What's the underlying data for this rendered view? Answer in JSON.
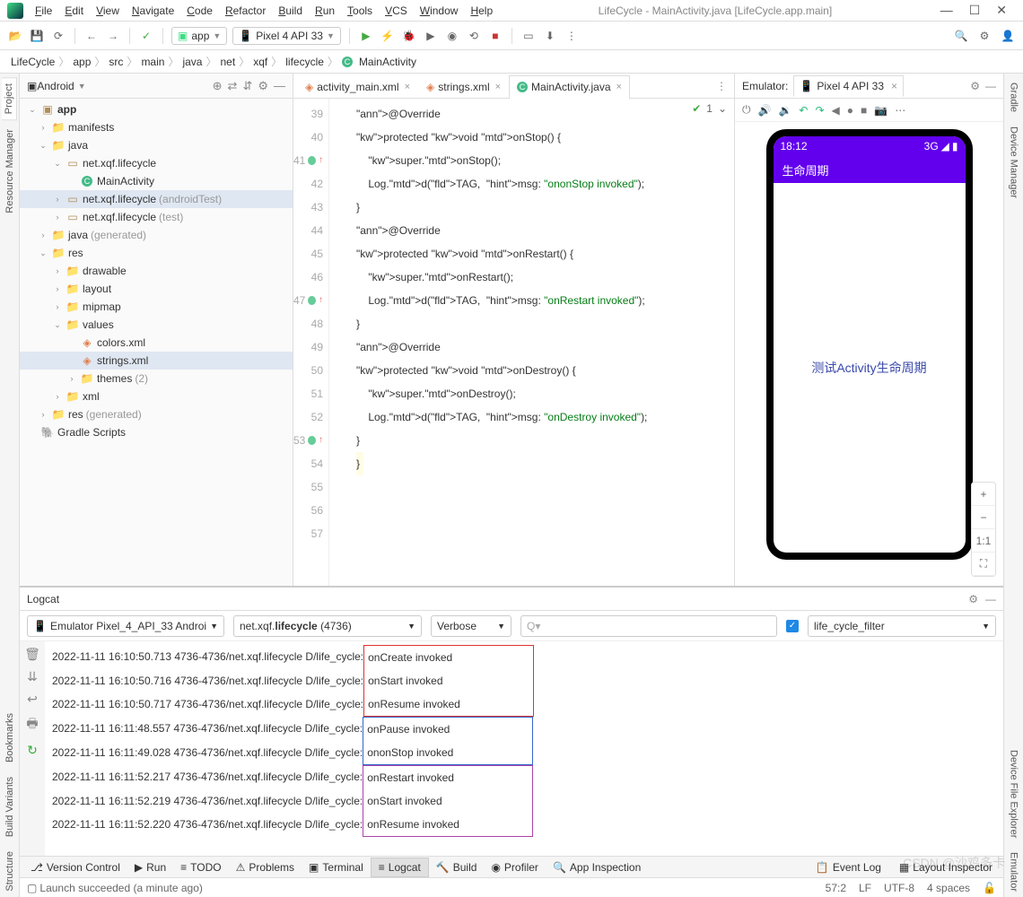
{
  "window": {
    "title_left": "LifeCycle - MainActivity.java [LifeCycle.app.main]"
  },
  "menu": [
    "File",
    "Edit",
    "View",
    "Navigate",
    "Code",
    "Refactor",
    "Build",
    "Run",
    "Tools",
    "VCS",
    "Window",
    "Help"
  ],
  "toolbar": {
    "module": "app",
    "device": "Pixel 4 API 33"
  },
  "breadcrumb": [
    "LifeCycle",
    "app",
    "src",
    "main",
    "java",
    "net",
    "xqf",
    "lifecycle",
    "MainActivity"
  ],
  "left_stripe": [
    "Project",
    "Resource Manager"
  ],
  "right_stripe": [
    "Gradle",
    "Device Manager"
  ],
  "left_stripe_bottom": [
    "Bookmarks",
    "Build Variants",
    "Structure"
  ],
  "right_stripe_bottom": [
    "Device File Explorer",
    "Emulator"
  ],
  "project": {
    "mode": "Android",
    "tree": [
      {
        "label": "app",
        "ind": 0,
        "open": true,
        "type": "module",
        "bold": true
      },
      {
        "label": "manifests",
        "ind": 1,
        "type": "folder"
      },
      {
        "label": "java",
        "ind": 1,
        "open": true,
        "type": "folder"
      },
      {
        "label": "net.xqf.lifecycle",
        "ind": 2,
        "open": true,
        "type": "pkg"
      },
      {
        "label": "MainActivity",
        "ind": 3,
        "type": "class"
      },
      {
        "label": "net.xqf.lifecycle",
        "suffix": "(androidTest)",
        "ind": 2,
        "type": "pkg",
        "sel": true
      },
      {
        "label": "net.xqf.lifecycle",
        "suffix": "(test)",
        "ind": 2,
        "type": "pkg"
      },
      {
        "label": "java",
        "suffix": "(generated)",
        "ind": 1,
        "type": "folder-gen"
      },
      {
        "label": "res",
        "ind": 1,
        "open": true,
        "type": "folder"
      },
      {
        "label": "drawable",
        "ind": 2,
        "type": "folder"
      },
      {
        "label": "layout",
        "ind": 2,
        "type": "folder"
      },
      {
        "label": "mipmap",
        "ind": 2,
        "type": "folder"
      },
      {
        "label": "values",
        "ind": 2,
        "open": true,
        "type": "folder"
      },
      {
        "label": "colors.xml",
        "ind": 3,
        "type": "xml"
      },
      {
        "label": "strings.xml",
        "ind": 3,
        "type": "xml",
        "sel": true
      },
      {
        "label": "themes",
        "suffix": "(2)",
        "ind": 3,
        "type": "folder"
      },
      {
        "label": "xml",
        "ind": 2,
        "type": "folder"
      },
      {
        "label": "res",
        "suffix": "(generated)",
        "ind": 1,
        "type": "folder-gen"
      },
      {
        "label": "Gradle Scripts",
        "ind": 0,
        "type": "gradle"
      }
    ]
  },
  "tabs": [
    {
      "label": "activity_main.xml",
      "icon": "xml"
    },
    {
      "label": "strings.xml",
      "icon": "xml"
    },
    {
      "label": "MainActivity.java",
      "icon": "class",
      "active": true
    }
  ],
  "editor_status": {
    "warnings": "1"
  },
  "lines": [
    {
      "n": 39,
      "code": ""
    },
    {
      "n": 40,
      "code": "@Override",
      "ann": true
    },
    {
      "n": 41,
      "ovr": true,
      "up": true,
      "code": "protected void onStop() {"
    },
    {
      "n": 42,
      "code": "    super.onStop();"
    },
    {
      "n": 43,
      "code": "    Log.d(TAG,  msg: \"ononStop invoked\");"
    },
    {
      "n": 44,
      "code": "}"
    },
    {
      "n": 45,
      "code": ""
    },
    {
      "n": 46,
      "code": "@Override",
      "ann": true
    },
    {
      "n": 47,
      "ovr": true,
      "up": true,
      "code": "protected void onRestart() {"
    },
    {
      "n": 48,
      "code": "    super.onRestart();"
    },
    {
      "n": 49,
      "code": "    Log.d(TAG,  msg: \"onRestart invoked\");"
    },
    {
      "n": 50,
      "code": "}"
    },
    {
      "n": 51,
      "code": ""
    },
    {
      "n": 52,
      "code": "@Override",
      "ann": true
    },
    {
      "n": 53,
      "ovr": true,
      "up": true,
      "code": "protected void onDestroy() {"
    },
    {
      "n": 54,
      "code": "    super.onDestroy();"
    },
    {
      "n": 55,
      "code": "    Log.d(TAG,  msg: \"onDestroy invoked\");"
    },
    {
      "n": 56,
      "code": "}"
    },
    {
      "n": 57,
      "code": "}",
      "last": true
    }
  ],
  "emulator": {
    "title": "Emulator:",
    "tab": "Pixel 4 API 33",
    "statusbar_time": "18:12",
    "statusbar_signal": "3G",
    "app_title": "生命周期",
    "content": "测试Activity生命周期",
    "zoom": [
      "+",
      "−",
      "1:1",
      "⛶"
    ]
  },
  "logcat": {
    "title": "Logcat",
    "device": "Emulator Pixel_4_API_33 Androi",
    "process": "net.xqf.lifecycle (4736)",
    "process_pkg": "net.xqf.",
    "process_bold": "lifecycle",
    "process_pid": " (4736)",
    "level": "Verbose",
    "search_placeholder": "Q▾",
    "filter": "life_cycle_filter",
    "lines": [
      {
        "ts": "2022-11-11 16:10:50.713",
        "rest": " 4736-4736/net.xqf.lifecycle D/life_cycle: ",
        "msg": "onCreate invoked",
        "grp": "red",
        "first": true
      },
      {
        "ts": "2022-11-11 16:10:50.716",
        "rest": " 4736-4736/net.xqf.lifecycle D/life_cycle: ",
        "msg": "onStart invoked",
        "grp": "red"
      },
      {
        "ts": "2022-11-11 16:10:50.717",
        "rest": " 4736-4736/net.xqf.lifecycle D/life_cycle: ",
        "msg": "onResume invoked",
        "grp": "red",
        "last": true
      },
      {
        "ts": "2022-11-11 16:11:48.557",
        "rest": " 4736-4736/net.xqf.lifecycle D/life_cycle: ",
        "msg": "onPause invoked",
        "grp": "blue",
        "first": true
      },
      {
        "ts": "2022-11-11 16:11:49.028",
        "rest": " 4736-4736/net.xqf.lifecycle D/life_cycle: ",
        "msg": "ononStop invoked",
        "grp": "blue",
        "last": true
      },
      {
        "ts": "2022-11-11 16:11:52.217",
        "rest": " 4736-4736/net.xqf.lifecycle D/life_cycle: ",
        "msg": "onRestart invoked",
        "grp": "purple",
        "first": true
      },
      {
        "ts": "2022-11-11 16:11:52.219",
        "rest": " 4736-4736/net.xqf.lifecycle D/life_cycle: ",
        "msg": "onStart invoked",
        "grp": "purple"
      },
      {
        "ts": "2022-11-11 16:11:52.220",
        "rest": " 4736-4736/net.xqf.lifecycle D/life_cycle: ",
        "msg": "onResume invoked",
        "grp": "purple",
        "last": true
      }
    ]
  },
  "bottom_tabs": [
    "Version Control",
    "Run",
    "TODO",
    "Problems",
    "Terminal",
    "Logcat",
    "Build",
    "Profiler",
    "App Inspection"
  ],
  "bottom_tabs_right": [
    "Event Log",
    "Layout Inspector"
  ],
  "bottom_active": "Logcat",
  "status": {
    "msg": "Launch succeeded (a minute ago)",
    "pos": "57:2",
    "sep": "LF",
    "enc": "UTF-8",
    "indent": "4 spaces"
  },
  "watermark": "CSDN @沙鸡多卡"
}
